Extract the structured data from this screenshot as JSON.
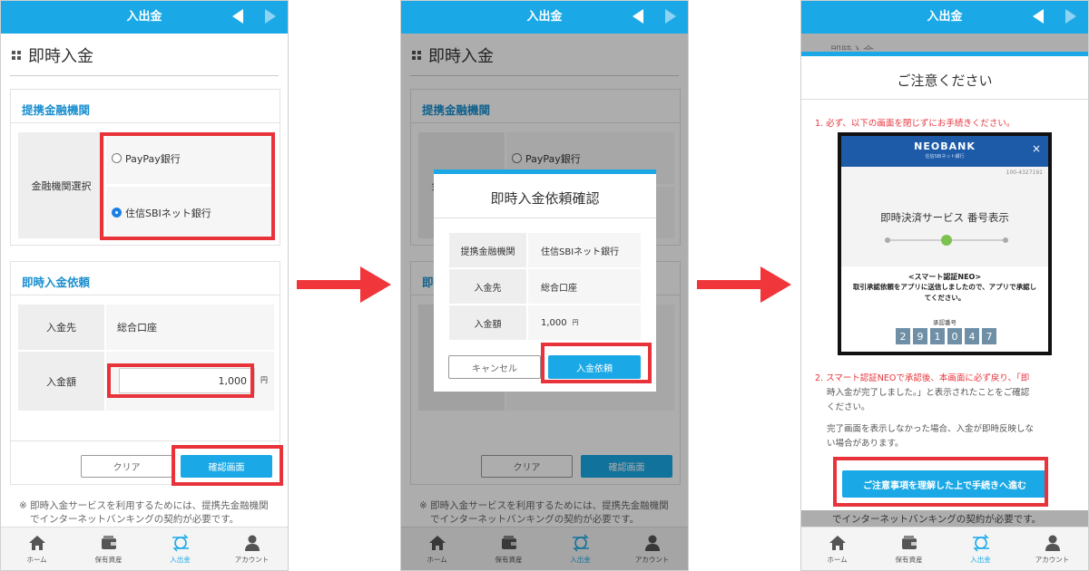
{
  "header": {
    "title": "入出金"
  },
  "page": {
    "title": "即時入金"
  },
  "bank_section": {
    "title": "提携金融機関",
    "label": "金融機関選択",
    "options": [
      "PayPay銀行",
      "住信SBIネット銀行"
    ]
  },
  "deposit_section": {
    "title": "即時入金依頼",
    "dest_label": "入金先",
    "dest_value": "総合口座",
    "amount_label": "入金額",
    "amount_value": "1,000",
    "unit": "円"
  },
  "buttons": {
    "clear": "クリア",
    "confirm": "確認画面"
  },
  "note": {
    "line1": "※ 即時入金サービスを利用するためには、提携先金融機関",
    "line2": "でインターネットバンキングの契約が必要です。"
  },
  "tabs": [
    "ホーム",
    "保有資産",
    "入出金",
    "アカウント"
  ],
  "dialog": {
    "title": "即時入金依頼確認",
    "rows": [
      {
        "label": "提携金融機関",
        "value": "住信SBIネット銀行"
      },
      {
        "label": "入金先",
        "value": "総合口座"
      },
      {
        "label": "入金額",
        "value": "1,000",
        "unit": "円"
      }
    ],
    "cancel": "キャンセル",
    "submit": "入金依頼"
  },
  "caution": {
    "partial_title": "即時入金",
    "title": "ご注意ください",
    "step1": "1. 必ず、以下の画面を閉じずにお手続きください。",
    "neobank": {
      "logo": "NEOBANK",
      "sub": "住信SBIネット銀行",
      "account": "100-4327191",
      "service": "即時決済サービス 番号表示",
      "neo_title": "<スマート認証NEO>",
      "neo_text": "取引承認依頼をアプリに送信しましたので、アプリで承認してください。",
      "code_label": "承認番号",
      "code": [
        "2",
        "9",
        "1",
        "0",
        "4",
        "7"
      ]
    },
    "step2_line1": "2. スマート認証NEOで承認後、本画面に必ず戻り、「即",
    "step2_line2": "時入金が完了しました。」と表示されたことをご確認",
    "step2_line3": "ください。",
    "info_line1": "完了画面を表示しなかった場合、入金が即時反映しな",
    "info_line2": "い場合があります。",
    "proceed": "ご注意事項を理解した上で手続きへ進む"
  },
  "colors": {
    "accent": "#1aa9e6",
    "highlight": "#e8333b",
    "arrow": "#f0353b"
  }
}
